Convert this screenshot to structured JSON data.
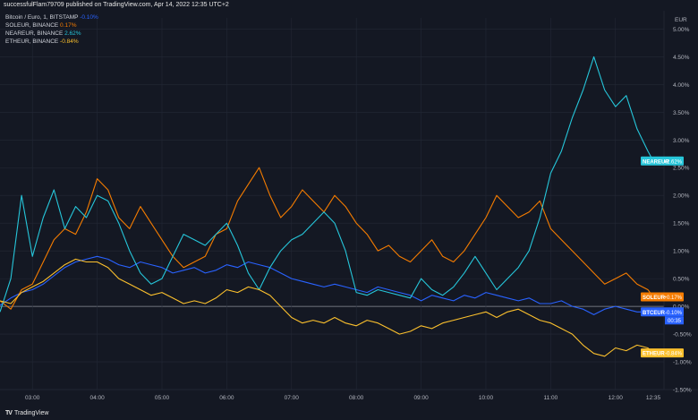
{
  "header": {
    "text": "successfulFlam79709 published on TradingView.com, Apr 14, 2022 12:35 UTC+2"
  },
  "footer": {
    "logo_text": "TradingView"
  },
  "colors": {
    "background": "#141823",
    "grid": "#232836",
    "axis_text": "#b2b5be",
    "zero_line": "#8c8f99",
    "btc": "#2962ff",
    "sol": "#f57c00",
    "near": "#26c6da",
    "eth": "#fbc02d"
  },
  "chart_data": {
    "type": "line",
    "title": "",
    "xlabel": "",
    "ylabel": "",
    "y_unit": "%",
    "y_axis_position": "right",
    "axis_label": "EUR",
    "grid": true,
    "legend_placement": "top-left",
    "x_ticks": [
      "03:00",
      "04:00",
      "05:00",
      "06:00",
      "07:00",
      "08:00",
      "09:00",
      "10:00",
      "11:00",
      "12:00",
      "12:35"
    ],
    "y_ticks": [
      "-1.50%",
      "-1.00%",
      "-0.50%",
      "0.00%",
      "0.50%",
      "1.00%",
      "1.50%",
      "2.00%",
      "2.50%",
      "3.00%",
      "3.50%",
      "4.00%",
      "4.50%",
      "5.00%"
    ],
    "ylim": [
      -1.5,
      5.2
    ],
    "xlim": [
      "02:30",
      "12:35"
    ],
    "series": [
      {
        "key": "btc",
        "name": "BTCEUR",
        "legend_name": "Bitcoin / Euro, 1, BITSTAMP",
        "legend_value": "-0.10%",
        "last_label": "-0.10%",
        "countdown": "00:35",
        "x": [
          "02:30",
          "02:40",
          "02:50",
          "03:00",
          "03:10",
          "03:20",
          "03:30",
          "03:40",
          "03:50",
          "04:00",
          "04:10",
          "04:20",
          "04:30",
          "04:40",
          "04:50",
          "05:00",
          "05:10",
          "05:20",
          "05:30",
          "05:40",
          "05:50",
          "06:00",
          "06:10",
          "06:20",
          "06:30",
          "06:40",
          "06:50",
          "07:00",
          "07:10",
          "07:20",
          "07:30",
          "07:40",
          "07:50",
          "08:00",
          "08:10",
          "08:20",
          "08:30",
          "08:40",
          "08:50",
          "09:00",
          "09:10",
          "09:20",
          "09:30",
          "09:40",
          "09:50",
          "10:00",
          "10:10",
          "10:20",
          "10:30",
          "10:40",
          "10:50",
          "11:00",
          "11:10",
          "11:20",
          "11:30",
          "11:40",
          "11:50",
          "12:00",
          "12:10",
          "12:20",
          "12:30",
          "12:35"
        ],
        "y": [
          0.02,
          0.15,
          0.25,
          0.3,
          0.4,
          0.55,
          0.7,
          0.8,
          0.85,
          0.9,
          0.85,
          0.75,
          0.7,
          0.8,
          0.75,
          0.7,
          0.6,
          0.65,
          0.7,
          0.6,
          0.65,
          0.75,
          0.7,
          0.8,
          0.75,
          0.7,
          0.6,
          0.5,
          0.45,
          0.4,
          0.35,
          0.4,
          0.35,
          0.3,
          0.25,
          0.35,
          0.3,
          0.25,
          0.2,
          0.1,
          0.2,
          0.15,
          0.1,
          0.2,
          0.15,
          0.25,
          0.2,
          0.15,
          0.1,
          0.15,
          0.05,
          0.05,
          0.1,
          0.0,
          -0.05,
          -0.15,
          -0.05,
          0.0,
          -0.05,
          -0.1,
          -0.1,
          -0.1
        ]
      },
      {
        "key": "sol",
        "name": "SOLEUR",
        "legend_name": "SOLEUR, BINANCE",
        "legend_value": "0.17%",
        "last_label": "+0.17%",
        "x": [
          "02:30",
          "02:40",
          "02:50",
          "03:00",
          "03:10",
          "03:20",
          "03:30",
          "03:40",
          "03:50",
          "04:00",
          "04:10",
          "04:20",
          "04:30",
          "04:40",
          "04:50",
          "05:00",
          "05:10",
          "05:20",
          "05:30",
          "05:40",
          "05:50",
          "06:00",
          "06:10",
          "06:20",
          "06:30",
          "06:40",
          "06:50",
          "07:00",
          "07:10",
          "07:20",
          "07:30",
          "07:40",
          "07:50",
          "08:00",
          "08:10",
          "08:20",
          "08:30",
          "08:40",
          "08:50",
          "09:00",
          "09:10",
          "09:20",
          "09:30",
          "09:40",
          "09:50",
          "10:00",
          "10:10",
          "10:20",
          "10:30",
          "10:40",
          "10:50",
          "11:00",
          "11:10",
          "11:20",
          "11:30",
          "11:40",
          "11:50",
          "12:00",
          "12:10",
          "12:20",
          "12:30",
          "12:35"
        ],
        "y": [
          0.1,
          -0.05,
          0.3,
          0.4,
          0.8,
          1.2,
          1.4,
          1.3,
          1.7,
          2.3,
          2.1,
          1.6,
          1.4,
          1.8,
          1.5,
          1.2,
          0.9,
          0.7,
          0.8,
          0.9,
          1.3,
          1.4,
          1.9,
          2.2,
          2.5,
          2.0,
          1.6,
          1.8,
          2.1,
          1.9,
          1.7,
          2.0,
          1.8,
          1.5,
          1.3,
          1.0,
          1.1,
          0.9,
          0.8,
          1.0,
          1.2,
          0.9,
          0.8,
          1.0,
          1.3,
          1.6,
          2.0,
          1.8,
          1.6,
          1.7,
          1.9,
          1.4,
          1.2,
          1.0,
          0.8,
          0.6,
          0.4,
          0.5,
          0.6,
          0.4,
          0.3,
          0.17
        ]
      },
      {
        "key": "near",
        "name": "NEAREUR",
        "legend_name": "NEAREUR, BINANCE",
        "legend_value": "2.62%",
        "last_label": "+2.62%",
        "x": [
          "02:30",
          "02:40",
          "02:50",
          "03:00",
          "03:10",
          "03:20",
          "03:30",
          "03:40",
          "03:50",
          "04:00",
          "04:10",
          "04:20",
          "04:30",
          "04:40",
          "04:50",
          "05:00",
          "05:10",
          "05:20",
          "05:30",
          "05:40",
          "05:50",
          "06:00",
          "06:10",
          "06:20",
          "06:30",
          "06:40",
          "06:50",
          "07:00",
          "07:10",
          "07:20",
          "07:30",
          "07:40",
          "07:50",
          "08:00",
          "08:10",
          "08:20",
          "08:30",
          "08:40",
          "08:50",
          "09:00",
          "09:10",
          "09:20",
          "09:30",
          "09:40",
          "09:50",
          "10:00",
          "10:10",
          "10:20",
          "10:30",
          "10:40",
          "10:50",
          "11:00",
          "11:10",
          "11:20",
          "11:30",
          "11:40",
          "11:50",
          "12:00",
          "12:10",
          "12:20",
          "12:30",
          "12:35"
        ],
        "y": [
          -0.1,
          0.5,
          2.0,
          0.9,
          1.6,
          2.1,
          1.4,
          1.8,
          1.6,
          2.0,
          1.9,
          1.5,
          1.0,
          0.6,
          0.4,
          0.5,
          0.9,
          1.3,
          1.2,
          1.1,
          1.3,
          1.5,
          1.1,
          0.6,
          0.3,
          0.7,
          1.0,
          1.2,
          1.3,
          1.5,
          1.7,
          1.5,
          1.0,
          0.25,
          0.2,
          0.3,
          0.25,
          0.2,
          0.15,
          0.5,
          0.3,
          0.2,
          0.35,
          0.6,
          0.9,
          0.6,
          0.3,
          0.5,
          0.7,
          1.0,
          1.6,
          2.4,
          2.8,
          3.4,
          3.9,
          4.5,
          3.9,
          3.6,
          3.8,
          3.2,
          2.8,
          2.62
        ]
      },
      {
        "key": "eth",
        "name": "ETHEUR",
        "legend_name": "ETHEUR, BINANCE",
        "legend_value": "-0.84%",
        "last_label": "-0.84%",
        "x": [
          "02:30",
          "02:40",
          "02:50",
          "03:00",
          "03:10",
          "03:20",
          "03:30",
          "03:40",
          "03:50",
          "04:00",
          "04:10",
          "04:20",
          "04:30",
          "04:40",
          "04:50",
          "05:00",
          "05:10",
          "05:20",
          "05:30",
          "05:40",
          "05:50",
          "06:00",
          "06:10",
          "06:20",
          "06:30",
          "06:40",
          "06:50",
          "07:00",
          "07:10",
          "07:20",
          "07:30",
          "07:40",
          "07:50",
          "08:00",
          "08:10",
          "08:20",
          "08:30",
          "08:40",
          "08:50",
          "09:00",
          "09:10",
          "09:20",
          "09:30",
          "09:40",
          "09:50",
          "10:00",
          "10:10",
          "10:20",
          "10:30",
          "10:40",
          "10:50",
          "11:00",
          "11:10",
          "11:20",
          "11:30",
          "11:40",
          "11:50",
          "12:00",
          "12:10",
          "12:20",
          "12:30",
          "12:35"
        ],
        "y": [
          0.1,
          0.05,
          0.25,
          0.35,
          0.45,
          0.6,
          0.75,
          0.85,
          0.8,
          0.8,
          0.7,
          0.5,
          0.4,
          0.3,
          0.2,
          0.25,
          0.15,
          0.05,
          0.1,
          0.05,
          0.15,
          0.3,
          0.25,
          0.35,
          0.3,
          0.2,
          0.0,
          -0.2,
          -0.3,
          -0.25,
          -0.3,
          -0.2,
          -0.3,
          -0.35,
          -0.25,
          -0.3,
          -0.4,
          -0.5,
          -0.45,
          -0.35,
          -0.4,
          -0.3,
          -0.25,
          -0.2,
          -0.15,
          -0.1,
          -0.2,
          -0.1,
          -0.05,
          -0.15,
          -0.25,
          -0.3,
          -0.4,
          -0.5,
          -0.7,
          -0.85,
          -0.9,
          -0.75,
          -0.8,
          -0.7,
          -0.75,
          -0.84
        ]
      }
    ]
  }
}
